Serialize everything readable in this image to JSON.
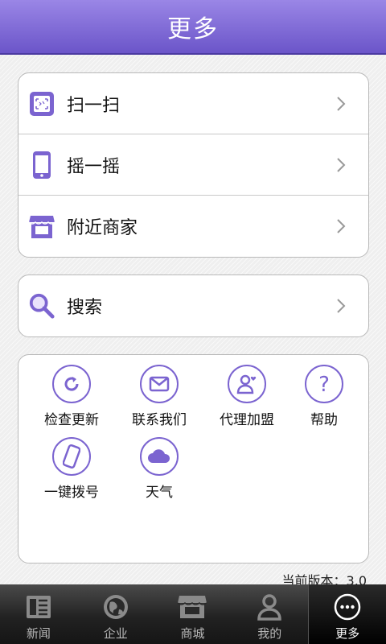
{
  "header": {
    "title": "更多"
  },
  "menu_group_1": [
    {
      "label": "扫一扫",
      "icon": "scan-icon"
    },
    {
      "label": "摇一摇",
      "icon": "phone-shake-icon"
    },
    {
      "label": "附近商家",
      "icon": "store-icon"
    }
  ],
  "menu_group_2": [
    {
      "label": "搜索",
      "icon": "search-icon"
    }
  ],
  "grid": [
    {
      "label": "检查更新",
      "icon": "refresh-icon"
    },
    {
      "label": "联系我们",
      "icon": "mail-icon"
    },
    {
      "label": "代理加盟",
      "icon": "user-heart-icon"
    },
    {
      "label": "帮助",
      "icon": "question-icon"
    },
    {
      "label": "一键拨号",
      "icon": "phone-icon"
    },
    {
      "label": "天气",
      "icon": "cloud-icon"
    }
  ],
  "version": "当前版本：3.0",
  "tabs": [
    {
      "label": "新闻",
      "icon": "news-icon",
      "active": false
    },
    {
      "label": "企业",
      "icon": "globe-icon",
      "active": false
    },
    {
      "label": "商城",
      "icon": "shop-icon",
      "active": false
    },
    {
      "label": "我的",
      "icon": "person-icon",
      "active": false
    },
    {
      "label": "更多",
      "icon": "more-icon",
      "active": true
    }
  ],
  "colors": {
    "accent": "#7b64d0",
    "header": "#7a63d4",
    "tabbar": "#222222"
  }
}
